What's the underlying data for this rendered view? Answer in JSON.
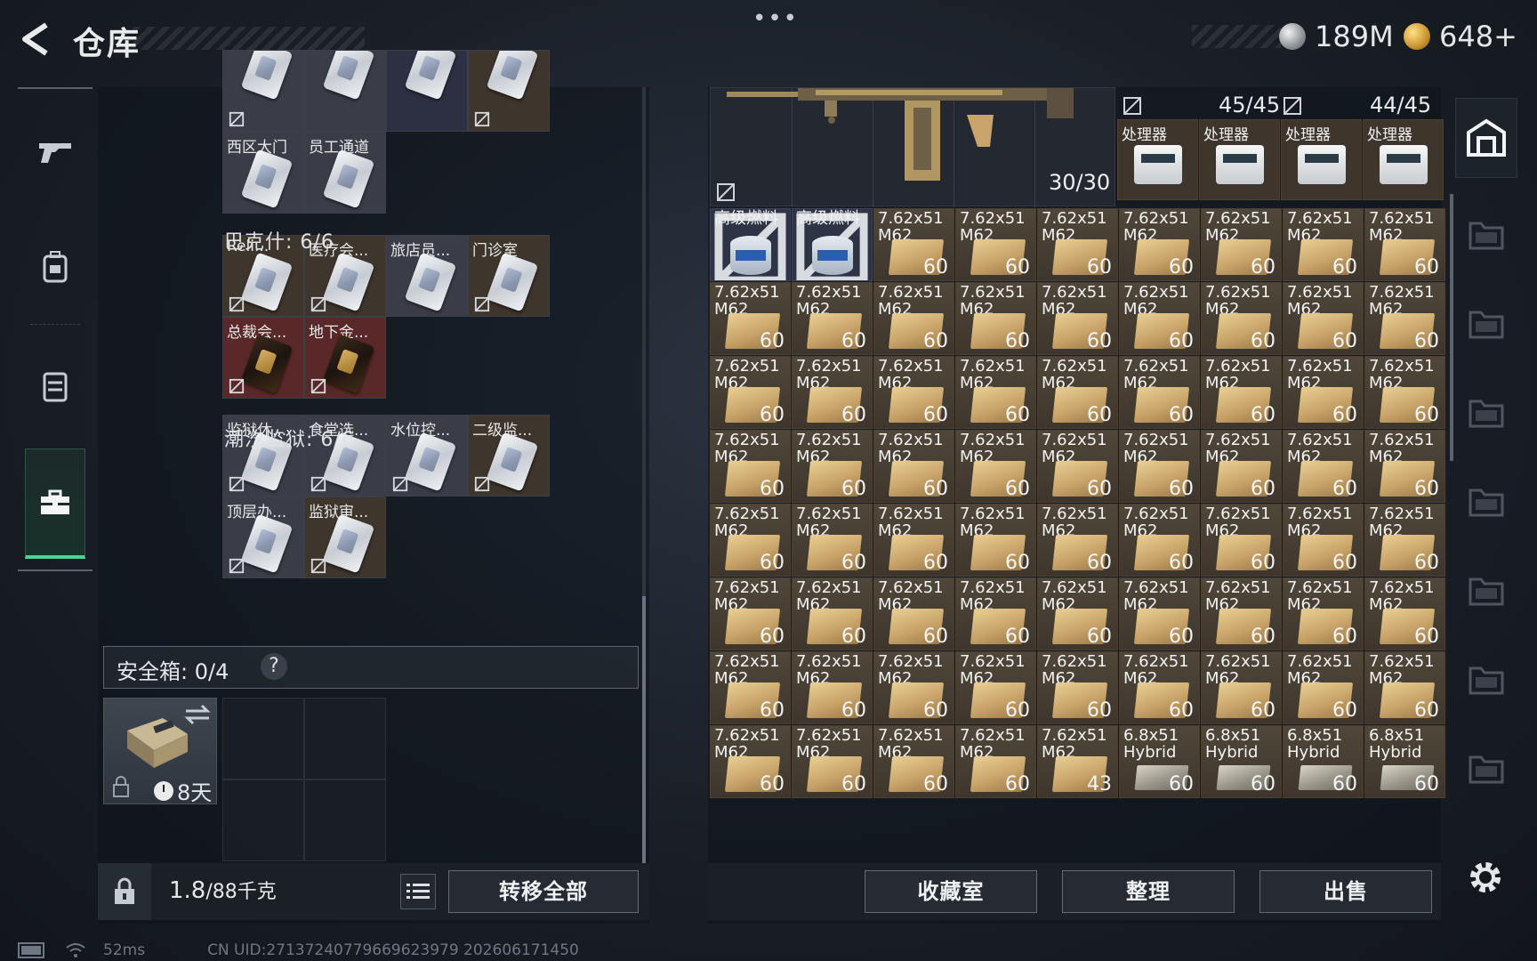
{
  "header": {
    "title": "仓库",
    "silver_amount": "189M",
    "gold_amount": "648+",
    "dots": "•••"
  },
  "left": {
    "top_row_cards": [
      {
        "color": "gray"
      },
      {
        "color": "gray"
      },
      {
        "color": "navy"
      },
      {
        "color": "brown"
      }
    ],
    "group0_cards": [
      {
        "name": "西区大门",
        "color": "gray"
      },
      {
        "name": "员工通道",
        "color": "gray"
      }
    ],
    "group1_label": "巴克什: 6/6",
    "group1_cards": [
      {
        "name": "Reli...",
        "color": "brown"
      },
      {
        "name": "医疗会...",
        "color": "brown"
      },
      {
        "name": "旅店员...",
        "color": "gray"
      },
      {
        "name": "门诊室",
        "color": "brown"
      },
      {
        "name": "总裁会...",
        "color": "red"
      },
      {
        "name": "地下金...",
        "color": "red"
      }
    ],
    "group2_label": "潮汐监狱: 6/6",
    "group2_cards": [
      {
        "name": "监狱休...",
        "color": "gray"
      },
      {
        "name": "食堂选...",
        "color": "gray"
      },
      {
        "name": "水位控...",
        "color": "gray"
      },
      {
        "name": "二级监...",
        "color": "brown"
      },
      {
        "name": "顶层办...",
        "color": "gray"
      },
      {
        "name": "监狱审...",
        "color": "brown"
      }
    ],
    "safe_label": "安全箱: 0/4",
    "safe_help": "?",
    "safe_time": "8天",
    "weight_current": "1.8",
    "weight_max": "/88千克",
    "transfer_all": "转移全部"
  },
  "right": {
    "gun_count": "30/30",
    "proc_count_a": "45/45",
    "proc_count_b": "44/45",
    "processors": [
      "处理器",
      "处理器",
      "处理器",
      "处理器"
    ],
    "ammo_name": "7.62x51\nM62",
    "ammo_qty": "60",
    "fuel_name": "高级燃料",
    "alt_ammo_name": "6.8x51\nHybrid",
    "last_ammo_qty": "43",
    "buttons": {
      "collection": "收藏室",
      "organize": "整理",
      "sell": "出售"
    }
  },
  "status": {
    "ping": "52ms",
    "uid": "CN UID:271372407796696239​79 202606171450"
  },
  "colors": {
    "accent_green": "#4cd493",
    "card_gray": "#3a3d48",
    "card_brown": "#3e352c",
    "card_red": "#5a2828"
  }
}
